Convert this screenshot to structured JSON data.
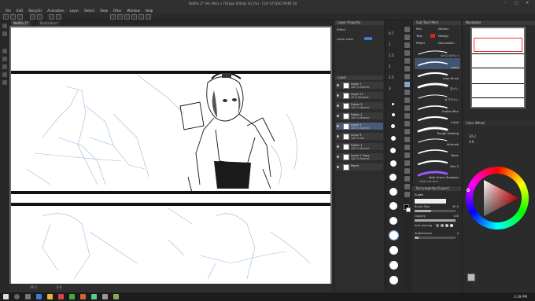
{
  "window": {
    "title": "Netflix 2* (A4 4961 x 7016px 600dpi 30.2%) - CLIP STUDIO PAINT EX",
    "controls": [
      "–",
      "□",
      "✕"
    ]
  },
  "menu": [
    "File",
    "Edit",
    "Story(S)",
    "Animation",
    "Layer",
    "Select",
    "View",
    "Filter",
    "Window",
    "Help"
  ],
  "tabs": [
    {
      "label": "Netflix 2*"
    },
    {
      "label": "Illustration*"
    }
  ],
  "status": {
    "zoom": "30.2",
    "coords": "0.0"
  },
  "layer_panel": {
    "header": "Layer Property",
    "effect_label": "Effect",
    "layer_color_label": "Layer color",
    "layer_header": "Layer",
    "layers": [
      {
        "blend": "100 % Normal",
        "name": "Layer 7"
      },
      {
        "blend": "70 % Multiple",
        "name": "Layer 11"
      },
      {
        "blend": "100 % Normal",
        "name": "Folder 3"
      },
      {
        "blend": "100 % Normal",
        "name": "Folder 1"
      },
      {
        "blend": "100 % Normal",
        "name": "Layer 2"
      },
      {
        "blend": "100 % Nor",
        "name": "Layer 3"
      },
      {
        "blend": "100 % Normal",
        "name": "Folder 1"
      },
      {
        "blend": "100 % Normal",
        "name": "Layer 1 Copy"
      },
      {
        "blend": "",
        "name": "Paper"
      }
    ]
  },
  "brush_sizes": [
    "0.7",
    "1",
    "1.5",
    "2",
    "2.5",
    "3"
  ],
  "sub_tool": {
    "header": "Sub Tool [Pen]",
    "tabs": [
      "Pen",
      "Marker",
      "Text",
      "Design",
      "Effect",
      "Decoration"
    ],
    "brushes": [
      {
        "name": "Gペン(Gペン)"
      },
      {
        "name": "Loom"
      },
      {
        "name": "Loop Brush"
      },
      {
        "name": "丸ペン"
      },
      {
        "name": "カブラペン"
      },
      {
        "name": "Outline Blur"
      },
      {
        "name": "Inkial"
      },
      {
        "name": "Rough Shading"
      },
      {
        "name": "Airbrush"
      },
      {
        "name": "Basic"
      },
      {
        "name": "Blur 2"
      },
      {
        "name": "Kath Grey's Shadows"
      }
    ],
    "add_button": "Add sub tool"
  },
  "tool_property": {
    "header": "Tool property [G-pen]",
    "brush_name": "G-pen",
    "brush_size_label": "Brush Size",
    "brush_size_value": "40.0",
    "opacity_label": "Opacity",
    "opacity_value": "100",
    "antialias_label": "Anti-aliasing",
    "stabilization_label": "Stabilization",
    "stabilization_value": "4",
    "fraction_opacity": 1.0,
    "fraction_brush": 0.4,
    "fraction_stab": 0.1
  },
  "navigator": {
    "header": "Navigator",
    "zoom": "30.2",
    "rotation": "0.0",
    "color_label": "Color Wheel"
  },
  "taskbar": {
    "clock": "2:39 PM"
  },
  "colors": {
    "accent": "#4a5a78",
    "selected_layer": "#4a5a78",
    "main_color": "#ff0000"
  }
}
